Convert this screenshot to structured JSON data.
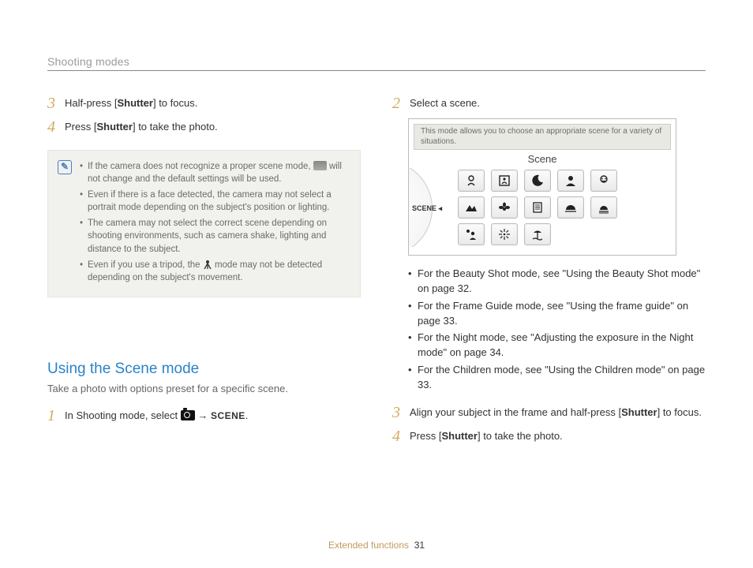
{
  "header": {
    "section": "Shooting modes"
  },
  "left": {
    "steps": [
      {
        "num": "3",
        "pre": "Half-press [",
        "bold": "Shutter",
        "post": "] to focus."
      },
      {
        "num": "4",
        "pre": "Press [",
        "bold": "Shutter",
        "post": "] to take the photo."
      }
    ],
    "notes": [
      {
        "a": "If the camera does not recognize a proper scene mode, ",
        "b": " will not change and the default settings will be used.",
        "icon": "smart-icon"
      },
      {
        "a": "Even if there is a face detected, the camera may not select a portrait mode depending on the subject's position or lighting.",
        "b": "",
        "icon": null
      },
      {
        "a": "The camera may not select the correct scene depending on shooting environments, such as camera shake, lighting and distance to the subject.",
        "b": "",
        "icon": null
      },
      {
        "a": "Even if you use a tripod, the ",
        "b": " mode may not be detected depending on the subject's movement.",
        "icon": "tripod-icon"
      }
    ],
    "section_title": "Using the Scene mode",
    "section_sub": "Take a photo with options preset for a specific scene.",
    "step1": {
      "num": "1",
      "text_a": "In Shooting mode, select ",
      "text_b": " → ",
      "scene_word": "SCENE",
      "text_c": "."
    }
  },
  "right": {
    "step2": {
      "num": "2",
      "text": "Select a scene."
    },
    "scene_caption": "This mode allows you to choose an appropriate scene for a variety of situations.",
    "scene_title": "Scene",
    "dial_label": "SCENE",
    "tiles": [
      [
        "beauty-shot-icon",
        "frame-guide-icon",
        "night-icon",
        "portrait-icon",
        "children-icon"
      ],
      [
        "landscape-icon",
        "closeup-icon",
        "text-icon",
        "sunset-icon",
        "dawn-icon"
      ],
      [
        "backlight-icon",
        "fireworks-icon",
        "beach-snow-icon"
      ]
    ],
    "refs": [
      "For the Beauty Shot mode, see \"Using the Beauty Shot mode\" on page 32.",
      "For the Frame Guide mode, see \"Using the frame guide\" on page 33.",
      "For the Night mode, see \"Adjusting the exposure in the Night mode\" on page 34.",
      "For the Children mode, see \"Using the Children mode\" on page 33."
    ],
    "step3": {
      "num": "3",
      "pre": "Align your subject in the frame and half-press [",
      "bold": "Shutter",
      "post": "] to focus."
    },
    "step4": {
      "num": "4",
      "pre": "Press [",
      "bold": "Shutter",
      "post": "] to take the photo."
    }
  },
  "footer": {
    "label": "Extended functions",
    "page": "31"
  }
}
